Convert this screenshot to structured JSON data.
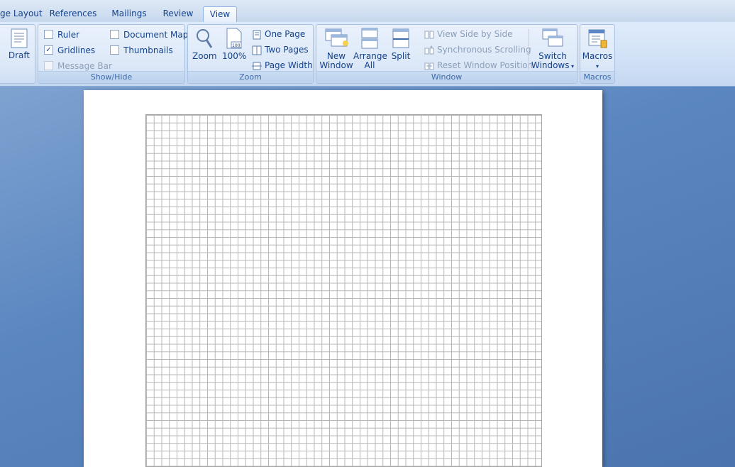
{
  "tabs": [
    {
      "label": "ge Layout",
      "active": false
    },
    {
      "label": "References",
      "active": false
    },
    {
      "label": "Mailings",
      "active": false
    },
    {
      "label": "Review",
      "active": false
    },
    {
      "label": "View",
      "active": true
    }
  ],
  "views": {
    "draft": "Draft"
  },
  "show_hide": {
    "label": "Show/Hide",
    "ruler": {
      "label": "Ruler",
      "checked": false
    },
    "gridlines": {
      "label": "Gridlines",
      "checked": true
    },
    "message_bar": {
      "label": "Message Bar",
      "checked": false,
      "disabled": true
    },
    "document_map": {
      "label": "Document Map",
      "checked": false
    },
    "thumbnails": {
      "label": "Thumbnails",
      "checked": false
    }
  },
  "zoom": {
    "label": "Zoom",
    "zoom_button": "Zoom",
    "hundred": "100%",
    "one_page": "One Page",
    "two_pages": "Two Pages",
    "page_width": "Page Width"
  },
  "window": {
    "label": "Window",
    "new_window_1": "New",
    "new_window_2": "Window",
    "arrange_1": "Arrange",
    "arrange_2": "All",
    "split": "Split",
    "view_side_by_side": "View Side by Side",
    "sync_scrolling": "Synchronous Scrolling",
    "reset_position": "Reset Window Position",
    "switch_1": "Switch",
    "switch_2": "Windows"
  },
  "macros": {
    "label": "Macros",
    "button": "Macros"
  },
  "colors": {
    "accent": "#15428b",
    "ribbon": "#dce8f8",
    "workspace": "#5b86c0"
  }
}
